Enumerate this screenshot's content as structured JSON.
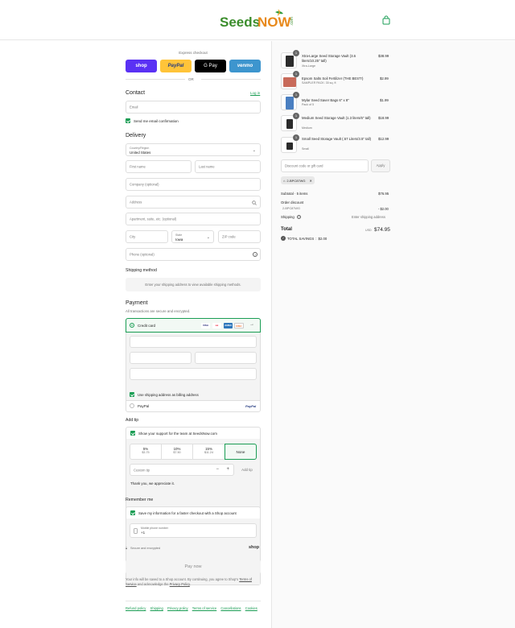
{
  "header": {
    "logo_text": "SeedsNOW",
    "logo_suffix": ".com",
    "cart_icon": "shopping-bag-icon"
  },
  "express": {
    "title": "Express checkout",
    "or_label": "OR",
    "buttons": [
      {
        "label": "shop",
        "color": "#5a31f4"
      },
      {
        "label": "PayPal",
        "color": "#ffc439"
      },
      {
        "label": "G Pay",
        "color": "#000000"
      },
      {
        "label": "venmo",
        "color": "#3d95ce"
      }
    ]
  },
  "contact": {
    "title": "Contact",
    "login_label": "Log in",
    "email_placeholder": "Email",
    "email_confirm_label": "Send me email confirmation"
  },
  "delivery": {
    "title": "Delivery",
    "country_label": "Country/Region",
    "country_value": "United States",
    "first_name": "First name",
    "last_name": "Last name",
    "company": "Company (optional)",
    "address": "Address",
    "apartment": "Apartment, suite, etc. (optional)",
    "city": "City",
    "state_label": "State",
    "state_value": "Iowa",
    "zip": "ZIP code",
    "phone": "Phone (optional)"
  },
  "shipping_method": {
    "title": "Shipping method",
    "message": "Enter your shipping address to view available shipping methods."
  },
  "payment": {
    "title": "Payment",
    "subtitle": "All transactions are secure and encrypted.",
    "credit_card_label": "Credit card",
    "card_brands": [
      "VISA",
      "MC",
      "AMEX",
      "DISC"
    ],
    "billing_same_label": "Use shipping address as billing address",
    "paypal_label": "PayPal",
    "paypal_logo": "PayPal"
  },
  "tip": {
    "title": "Add tip",
    "support_label": "Show your support for the team at SeedsNow.com",
    "options": [
      {
        "pct": "5%",
        "amount": "$3.75"
      },
      {
        "pct": "10%",
        "amount": "$7.50"
      },
      {
        "pct": "15%",
        "amount": "$11.24"
      },
      {
        "pct": "None",
        "amount": ""
      }
    ],
    "custom_placeholder": "Custom tip",
    "add_label": "Add tip",
    "thanks": "Thank you, we appreciate it."
  },
  "remember": {
    "title": "Remember me",
    "save_label": "Save my information for a faster checkout with a Shop account",
    "mobile_label": "Mobile phone number",
    "mobile_prefix": "+1",
    "secure_label": "Secure and encrypted",
    "shop_logo": "shop"
  },
  "pay_now_label": "Pay now",
  "legal": {
    "pre": "Your info will be saved to a Shop account. By continuing, you agree to Shop's",
    "terms": "Terms of Service",
    "mid": "and acknowledge the",
    "privacy": "Privacy Policy",
    "end": "."
  },
  "footer_links": [
    "Refund policy",
    "Shipping",
    "Privacy policy",
    "Terms of service",
    "Cancellations",
    "Cookies"
  ],
  "order": {
    "items": [
      {
        "qty": "1",
        "name": "Xtra-Large Seed Storage Vault (3.6 liters/10.25\" tall)",
        "variant": "Xtra-Large",
        "price": "$38.99"
      },
      {
        "qty": "1",
        "name": "Epsom Salts Soil Fertilizer (THE BEST!)",
        "variant": "SAMPLER PACK: 30 sq. ft",
        "price": "$2.99"
      },
      {
        "qty": "1",
        "name": "Mylar Seed Saver Bags 6\" x 8\"",
        "variant": "Pack of 5",
        "price": "$1.99"
      },
      {
        "qty": "1",
        "name": "Medium Seed Storage Vault (1.3 liters/6\" tall)",
        "variant": "Medium",
        "price": "$18.99"
      },
      {
        "qty": "1",
        "name": "Small Seed Storage Vault (.57 Liters/3.5\" tall)",
        "variant": "Small",
        "price": "$12.99"
      }
    ],
    "discount_placeholder": "Discount code or gift card",
    "apply_label": "Apply",
    "applied_code": "2-BPC87WG",
    "subtotal_label": "Subtotal · 5 items",
    "subtotal_value": "$76.95",
    "order_discount_label": "Order discount",
    "discount_code": "2-BPC87WG",
    "discount_value": "- $2.00",
    "shipping_label": "Shipping",
    "shipping_value": "Enter shipping address",
    "total_label": "Total",
    "total_currency": "USD",
    "total_value": "$74.95",
    "savings_label": "TOTAL SAVINGS",
    "savings_value": "$2.00"
  }
}
